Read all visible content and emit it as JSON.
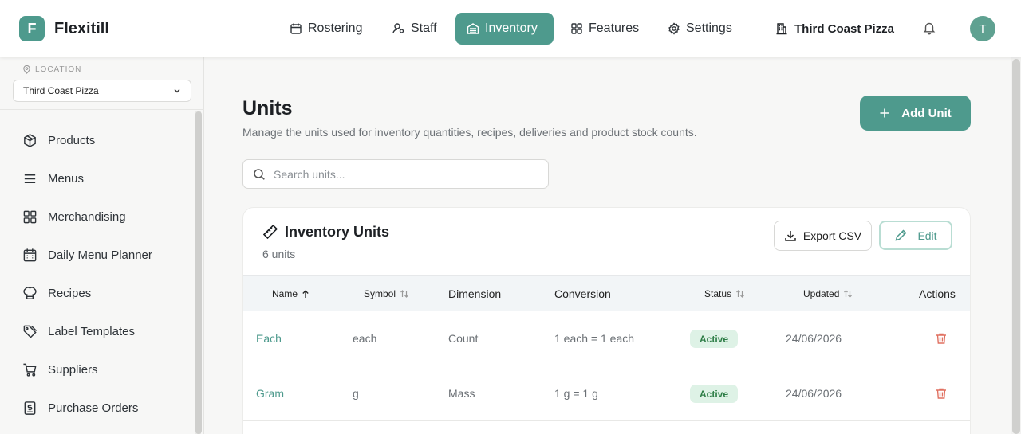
{
  "app": {
    "logo_letter": "F",
    "brand": "Flexitill"
  },
  "nav": {
    "items": [
      {
        "label": "Rostering",
        "icon": "calendar-icon"
      },
      {
        "label": "Staff",
        "icon": "staff-icon"
      },
      {
        "label": "Inventory",
        "icon": "inventory-icon",
        "active": true
      },
      {
        "label": "Features",
        "icon": "grid-icon"
      },
      {
        "label": "Settings",
        "icon": "gear-icon"
      }
    ],
    "location_label": "Third Coast Pizza",
    "avatar_initial": "T"
  },
  "sidebar": {
    "location_caption": "LOCATION",
    "location_value": "Third Coast Pizza",
    "items": [
      {
        "label": "Products",
        "icon": "box-icon"
      },
      {
        "label": "Menus",
        "icon": "menu-lines-icon"
      },
      {
        "label": "Merchandising",
        "icon": "grid-icon"
      },
      {
        "label": "Daily Menu Planner",
        "icon": "calendar-icon"
      },
      {
        "label": "Recipes",
        "icon": "chef-hat-icon"
      },
      {
        "label": "Label Templates",
        "icon": "tag-icon"
      },
      {
        "label": "Suppliers",
        "icon": "cart-icon"
      },
      {
        "label": "Purchase Orders",
        "icon": "invoice-icon"
      }
    ]
  },
  "page": {
    "title": "Units",
    "subtitle": "Manage the units used for inventory quantities, recipes, deliveries and product stock counts.",
    "add_button": "Add Unit",
    "search_placeholder": "Search units..."
  },
  "card": {
    "title": "Inventory Units",
    "count": "6 units",
    "export_label": "Export CSV",
    "edit_label": "Edit"
  },
  "table": {
    "headers": {
      "name": "Name",
      "symbol": "Symbol",
      "dimension": "Dimension",
      "conversion": "Conversion",
      "status": "Status",
      "updated": "Updated",
      "actions": "Actions"
    },
    "rows": [
      {
        "name": "Each",
        "symbol": "each",
        "dimension": "Count",
        "conversion": "1 each = 1 each",
        "status": "Active",
        "updated": "24/06/2026"
      },
      {
        "name": "Gram",
        "symbol": "g",
        "dimension": "Mass",
        "conversion": "1 g = 1 g",
        "status": "Active",
        "updated": "24/06/2026"
      }
    ]
  },
  "colors": {
    "accent": "#4e9a8d",
    "status_active_bg": "#def2e6",
    "status_active_text": "#2d7d46",
    "danger": "#e07060"
  }
}
